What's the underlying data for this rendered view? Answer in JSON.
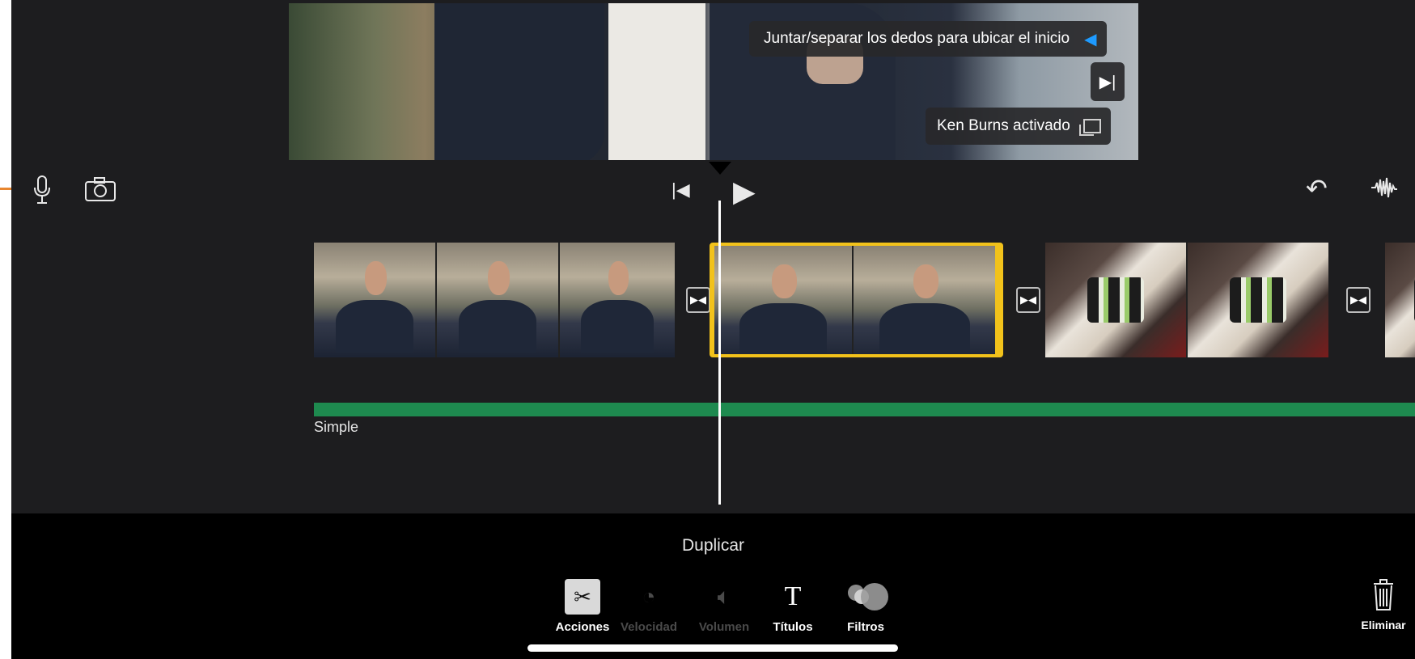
{
  "viewer": {
    "hint_text": "Juntar/separar los dedos para ubicar el inicio",
    "hint_icon": "skip-to-start-icon",
    "endframe_icon": "skip-to-end-icon",
    "kenburns_text": "Ken Burns activado",
    "kenburns_icon": "ken-burns-icon"
  },
  "timeline": {
    "toolbar_icons": [
      "microphone-icon",
      "camera-icon",
      "skip-start-icon",
      "play-icon",
      "undo-icon",
      "audio-waveform-icon"
    ],
    "clips": [
      {
        "name": "clip-1",
        "content": "person",
        "frames": 3,
        "selected": false
      },
      {
        "name": "clip-2",
        "content": "person",
        "frames": 2,
        "selected": true
      },
      {
        "name": "clip-3",
        "content": "sushi",
        "frames": 2,
        "selected": false
      },
      {
        "name": "clip-4",
        "content": "sushi",
        "frames": 1,
        "selected": false
      }
    ],
    "theme_label": "Simple",
    "selection_color": "#f2c21b",
    "theme_bar_color": "#1e8a4f"
  },
  "actions": {
    "title": "Duplicar",
    "tools": [
      {
        "label": "Acciones",
        "icon": "scissors-icon",
        "active": true
      },
      {
        "label": "Velocidad",
        "icon": "speedometer-icon",
        "enabled": false
      },
      {
        "label": "Volumen",
        "icon": "volume-icon",
        "enabled": false
      },
      {
        "label": "Títulos",
        "icon": "titles-icon",
        "enabled": true
      },
      {
        "label": "Filtros",
        "icon": "filters-icon",
        "enabled": true
      }
    ],
    "delete_label": "Eliminar",
    "delete_icon": "trash-icon"
  }
}
